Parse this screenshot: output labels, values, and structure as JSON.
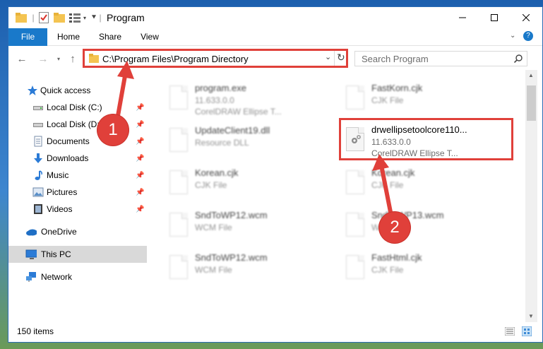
{
  "window": {
    "title": "Program"
  },
  "ribbon": {
    "tabs": [
      "File",
      "Home",
      "Share",
      "View"
    ]
  },
  "address": {
    "path": "C:\\Program Files\\Program Directory"
  },
  "search": {
    "placeholder": "Search Program"
  },
  "sidebar": {
    "items": [
      {
        "label": "Quick access",
        "icon": "star-icon"
      },
      {
        "label": "Local Disk (C:)",
        "icon": "drive-icon",
        "pinned": true
      },
      {
        "label": "Local Disk (D:)",
        "icon": "drive-icon",
        "pinned": true
      },
      {
        "label": "Documents",
        "icon": "documents-icon",
        "pinned": true
      },
      {
        "label": "Downloads",
        "icon": "download-icon",
        "pinned": true
      },
      {
        "label": "Music",
        "icon": "music-icon",
        "pinned": true
      },
      {
        "label": "Pictures",
        "icon": "pictures-icon",
        "pinned": true
      },
      {
        "label": "Videos",
        "icon": "videos-icon",
        "pinned": true
      },
      {
        "label": "OneDrive",
        "icon": "cloud-icon"
      },
      {
        "label": "This PC",
        "icon": "pc-icon",
        "selected": true
      },
      {
        "label": "Network",
        "icon": "network-icon"
      }
    ]
  },
  "files": {
    "left": [
      {
        "name": "program.exe",
        "line2": "11.633.0.0",
        "line3": "CorelDRAW Ellipse T..."
      },
      {
        "name": "UpdateClient19.dll",
        "line2": "Resource DLL",
        "line3": ""
      },
      {
        "name": "Korean.cjk",
        "line2": "CJK File",
        "line3": ""
      },
      {
        "name": "SndToWP12.wcm",
        "line2": "WCM File",
        "line3": ""
      },
      {
        "name": "SndToWP12.wcm",
        "line2": "WCM File",
        "line3": ""
      }
    ],
    "right": [
      {
        "name": "FastKorn.cjk",
        "line2": "CJK File",
        "line3": ""
      },
      {
        "name": "drwellipsetoolcore110...",
        "line2": "11.633.0.0",
        "line3": "CorelDRAW Ellipse T..."
      },
      {
        "name": "Korean.cjk",
        "line2": "CJK File",
        "line3": ""
      },
      {
        "name": "SndToWP13.wcm",
        "line2": "WCM File",
        "line3": ""
      },
      {
        "name": "FastHtml.cjk",
        "line2": "CJK File",
        "line3": ""
      }
    ]
  },
  "status": {
    "count": "150 items"
  },
  "annotations": {
    "step1": "1",
    "step2": "2"
  },
  "colors": {
    "accent": "#1979ca",
    "highlight": "#e0403a"
  }
}
